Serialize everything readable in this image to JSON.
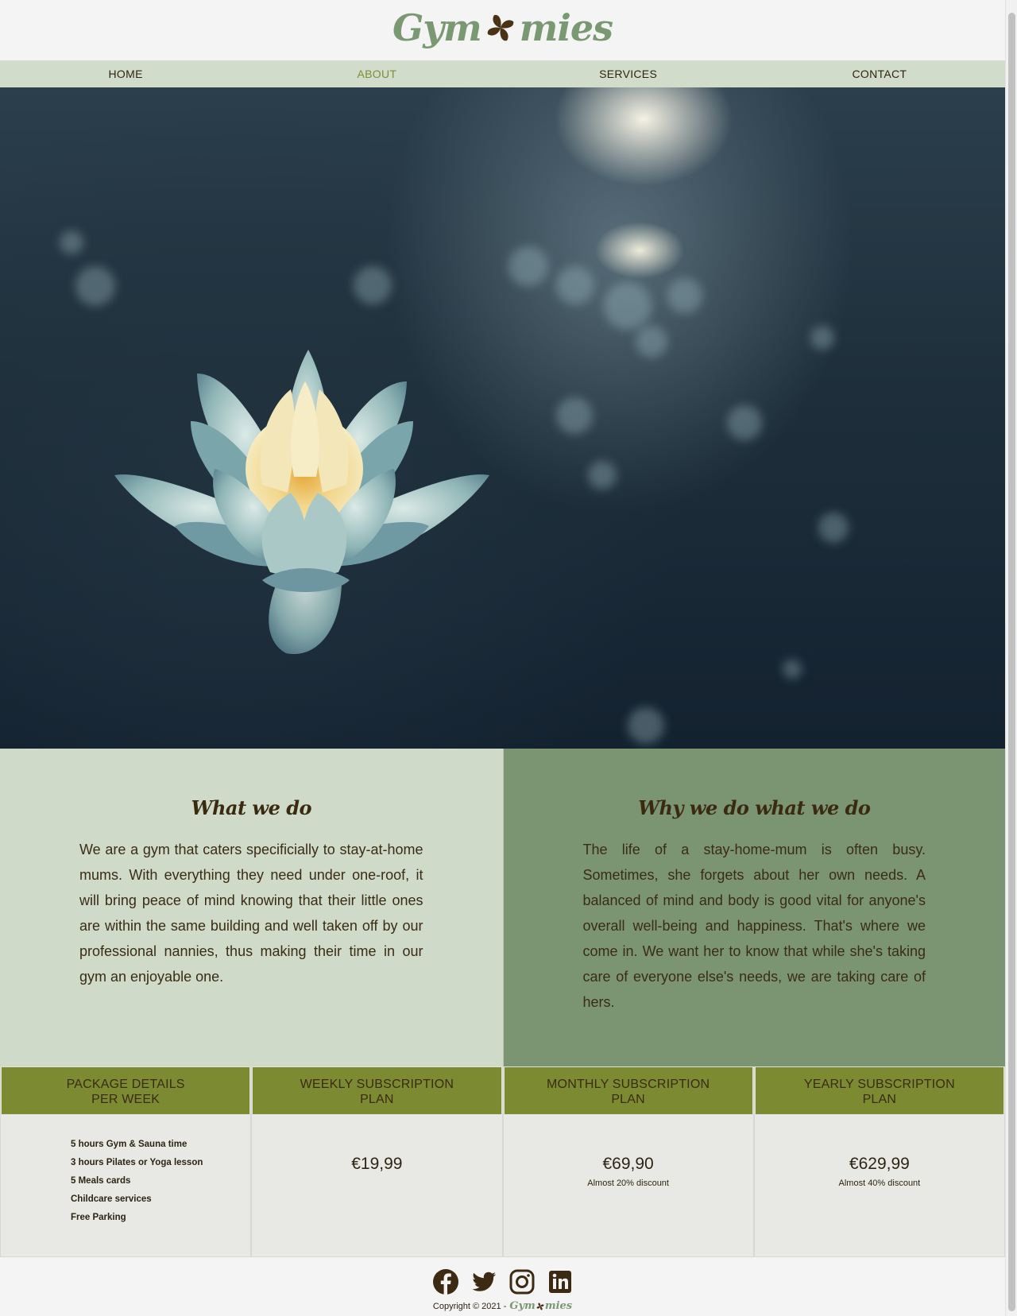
{
  "brand": {
    "logo_left": "Gym",
    "logo_right": "mies",
    "primary_color": "#7a9872",
    "accent_color": "#7c8b32"
  },
  "nav": {
    "items": [
      {
        "label": "HOME"
      },
      {
        "label": "ABOUT"
      },
      {
        "label": "SERVICES"
      },
      {
        "label": "CONTACT"
      }
    ],
    "active": "ABOUT"
  },
  "hero": {
    "image": "water-lily-photo"
  },
  "info": {
    "left": {
      "title": "What we do",
      "text": "We are a gym that caters specificially to stay-at-home mums. With everything they need under one-roof, it will bring peace of mind knowing that their little ones are within the same building and well taken off by our professional nannies, thus making their time in our gym an enjoyable one."
    },
    "right": {
      "title": "Why we do what we do",
      "text": "The life of a stay-home-mum is often busy. Sometimes, she forgets about her own needs. A balanced of mind and body is good vital for anyone's overall well-being and happiness. That's where we come in. We want her to know that while she's taking care of everyone else's needs, we are taking care of hers."
    }
  },
  "pricing": {
    "headers": [
      {
        "line1": "PACKAGE DETAILS",
        "line2": "PER WEEK"
      },
      {
        "line1": "WEEKLY SUBSCRIPTION",
        "line2": "PLAN"
      },
      {
        "line1": "MONTHLY SUBSCRIPTION",
        "line2": "PLAN"
      },
      {
        "line1": "YEARLY SUBSCRIPTION",
        "line2": "PLAN"
      }
    ],
    "details": [
      "5 hours Gym & Sauna time",
      "3 hours Pilates or Yoga lesson",
      "5 Meals cards",
      "Childcare services",
      "Free Parking"
    ],
    "weekly": {
      "price": "€19,99"
    },
    "monthly": {
      "price": "€69,90",
      "note": "Almost 20% discount"
    },
    "yearly": {
      "price": "€629,99",
      "note": "Almost 40% discount"
    }
  },
  "footer": {
    "social_icons": [
      "facebook-icon",
      "twitter-icon",
      "instagram-icon",
      "linkedin-icon"
    ],
    "copyright": "Copyright © 2021 -",
    "logo_left": "Gym",
    "logo_right": "mies"
  }
}
